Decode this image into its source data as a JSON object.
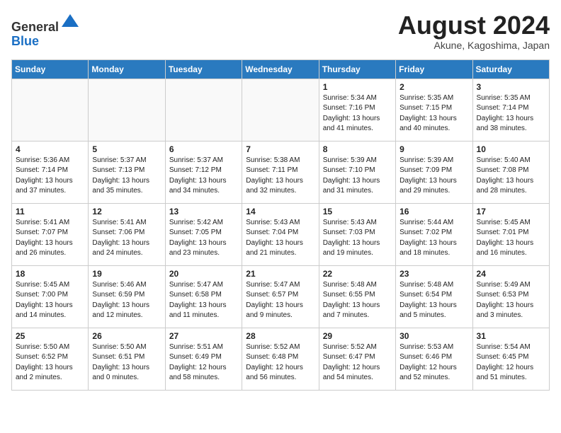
{
  "header": {
    "logo_line1": "General",
    "logo_line2": "Blue",
    "month_title": "August 2024",
    "location": "Akune, Kagoshima, Japan"
  },
  "weekdays": [
    "Sunday",
    "Monday",
    "Tuesday",
    "Wednesday",
    "Thursday",
    "Friday",
    "Saturday"
  ],
  "weeks": [
    [
      {
        "day": "",
        "info": ""
      },
      {
        "day": "",
        "info": ""
      },
      {
        "day": "",
        "info": ""
      },
      {
        "day": "",
        "info": ""
      },
      {
        "day": "1",
        "info": "Sunrise: 5:34 AM\nSunset: 7:16 PM\nDaylight: 13 hours\nand 41 minutes."
      },
      {
        "day": "2",
        "info": "Sunrise: 5:35 AM\nSunset: 7:15 PM\nDaylight: 13 hours\nand 40 minutes."
      },
      {
        "day": "3",
        "info": "Sunrise: 5:35 AM\nSunset: 7:14 PM\nDaylight: 13 hours\nand 38 minutes."
      }
    ],
    [
      {
        "day": "4",
        "info": "Sunrise: 5:36 AM\nSunset: 7:14 PM\nDaylight: 13 hours\nand 37 minutes."
      },
      {
        "day": "5",
        "info": "Sunrise: 5:37 AM\nSunset: 7:13 PM\nDaylight: 13 hours\nand 35 minutes."
      },
      {
        "day": "6",
        "info": "Sunrise: 5:37 AM\nSunset: 7:12 PM\nDaylight: 13 hours\nand 34 minutes."
      },
      {
        "day": "7",
        "info": "Sunrise: 5:38 AM\nSunset: 7:11 PM\nDaylight: 13 hours\nand 32 minutes."
      },
      {
        "day": "8",
        "info": "Sunrise: 5:39 AM\nSunset: 7:10 PM\nDaylight: 13 hours\nand 31 minutes."
      },
      {
        "day": "9",
        "info": "Sunrise: 5:39 AM\nSunset: 7:09 PM\nDaylight: 13 hours\nand 29 minutes."
      },
      {
        "day": "10",
        "info": "Sunrise: 5:40 AM\nSunset: 7:08 PM\nDaylight: 13 hours\nand 28 minutes."
      }
    ],
    [
      {
        "day": "11",
        "info": "Sunrise: 5:41 AM\nSunset: 7:07 PM\nDaylight: 13 hours\nand 26 minutes."
      },
      {
        "day": "12",
        "info": "Sunrise: 5:41 AM\nSunset: 7:06 PM\nDaylight: 13 hours\nand 24 minutes."
      },
      {
        "day": "13",
        "info": "Sunrise: 5:42 AM\nSunset: 7:05 PM\nDaylight: 13 hours\nand 23 minutes."
      },
      {
        "day": "14",
        "info": "Sunrise: 5:43 AM\nSunset: 7:04 PM\nDaylight: 13 hours\nand 21 minutes."
      },
      {
        "day": "15",
        "info": "Sunrise: 5:43 AM\nSunset: 7:03 PM\nDaylight: 13 hours\nand 19 minutes."
      },
      {
        "day": "16",
        "info": "Sunrise: 5:44 AM\nSunset: 7:02 PM\nDaylight: 13 hours\nand 18 minutes."
      },
      {
        "day": "17",
        "info": "Sunrise: 5:45 AM\nSunset: 7:01 PM\nDaylight: 13 hours\nand 16 minutes."
      }
    ],
    [
      {
        "day": "18",
        "info": "Sunrise: 5:45 AM\nSunset: 7:00 PM\nDaylight: 13 hours\nand 14 minutes."
      },
      {
        "day": "19",
        "info": "Sunrise: 5:46 AM\nSunset: 6:59 PM\nDaylight: 13 hours\nand 12 minutes."
      },
      {
        "day": "20",
        "info": "Sunrise: 5:47 AM\nSunset: 6:58 PM\nDaylight: 13 hours\nand 11 minutes."
      },
      {
        "day": "21",
        "info": "Sunrise: 5:47 AM\nSunset: 6:57 PM\nDaylight: 13 hours\nand 9 minutes."
      },
      {
        "day": "22",
        "info": "Sunrise: 5:48 AM\nSunset: 6:55 PM\nDaylight: 13 hours\nand 7 minutes."
      },
      {
        "day": "23",
        "info": "Sunrise: 5:48 AM\nSunset: 6:54 PM\nDaylight: 13 hours\nand 5 minutes."
      },
      {
        "day": "24",
        "info": "Sunrise: 5:49 AM\nSunset: 6:53 PM\nDaylight: 13 hours\nand 3 minutes."
      }
    ],
    [
      {
        "day": "25",
        "info": "Sunrise: 5:50 AM\nSunset: 6:52 PM\nDaylight: 13 hours\nand 2 minutes."
      },
      {
        "day": "26",
        "info": "Sunrise: 5:50 AM\nSunset: 6:51 PM\nDaylight: 13 hours\nand 0 minutes."
      },
      {
        "day": "27",
        "info": "Sunrise: 5:51 AM\nSunset: 6:49 PM\nDaylight: 12 hours\nand 58 minutes."
      },
      {
        "day": "28",
        "info": "Sunrise: 5:52 AM\nSunset: 6:48 PM\nDaylight: 12 hours\nand 56 minutes."
      },
      {
        "day": "29",
        "info": "Sunrise: 5:52 AM\nSunset: 6:47 PM\nDaylight: 12 hours\nand 54 minutes."
      },
      {
        "day": "30",
        "info": "Sunrise: 5:53 AM\nSunset: 6:46 PM\nDaylight: 12 hours\nand 52 minutes."
      },
      {
        "day": "31",
        "info": "Sunrise: 5:54 AM\nSunset: 6:45 PM\nDaylight: 12 hours\nand 51 minutes."
      }
    ]
  ]
}
